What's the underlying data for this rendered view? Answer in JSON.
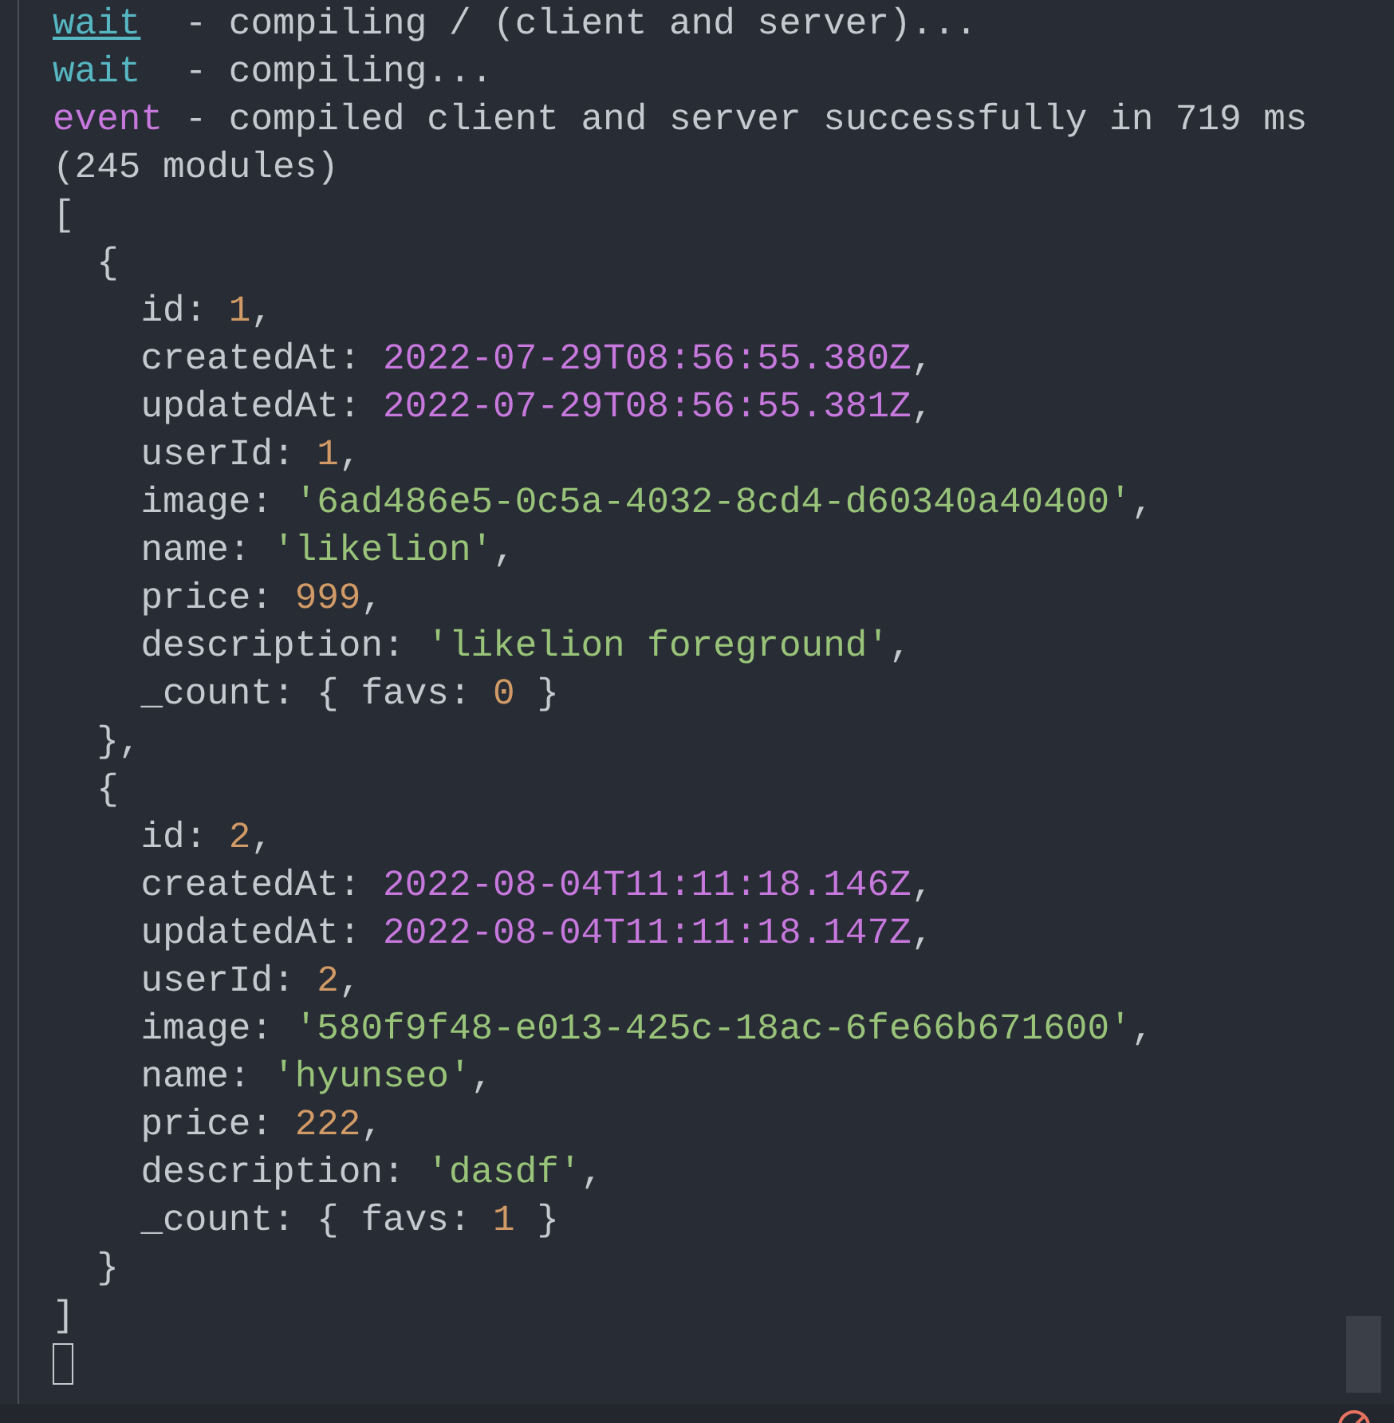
{
  "terminal": {
    "lines": [
      {
        "segments": [
          {
            "text": "wait",
            "kind": "link"
          },
          {
            "text": "  - compiling / (client and server)...",
            "kind": "plain"
          }
        ]
      },
      {
        "segments": [
          {
            "text": "wait",
            "kind": "info"
          },
          {
            "text": "  - compiling...",
            "kind": "plain"
          }
        ]
      },
      {
        "segments": [
          {
            "text": "event",
            "kind": "event"
          },
          {
            "text": " - compiled client and server successfully in 719 ms",
            "kind": "plain"
          }
        ]
      },
      {
        "segments": [
          {
            "text": "(245 modules)",
            "kind": "plain"
          }
        ]
      },
      {
        "segments": [
          {
            "text": "[",
            "kind": "plain"
          }
        ]
      },
      {
        "segments": [
          {
            "text": "  {",
            "kind": "plain"
          }
        ]
      },
      {
        "segments": [
          {
            "text": "    id: ",
            "kind": "plain"
          },
          {
            "text": "1",
            "kind": "number"
          },
          {
            "text": ",",
            "kind": "plain"
          }
        ]
      },
      {
        "segments": [
          {
            "text": "    createdAt: ",
            "kind": "plain"
          },
          {
            "text": "2022-07-29T08:56:55.380Z",
            "kind": "date"
          },
          {
            "text": ",",
            "kind": "plain"
          }
        ]
      },
      {
        "segments": [
          {
            "text": "    updatedAt: ",
            "kind": "plain"
          },
          {
            "text": "2022-07-29T08:56:55.381Z",
            "kind": "date"
          },
          {
            "text": ",",
            "kind": "plain"
          }
        ]
      },
      {
        "segments": [
          {
            "text": "    userId: ",
            "kind": "plain"
          },
          {
            "text": "1",
            "kind": "number"
          },
          {
            "text": ",",
            "kind": "plain"
          }
        ]
      },
      {
        "segments": [
          {
            "text": "    image: ",
            "kind": "plain"
          },
          {
            "text": "'6ad486e5-0c5a-4032-8cd4-d60340a40400'",
            "kind": "string"
          },
          {
            "text": ",",
            "kind": "plain"
          }
        ]
      },
      {
        "segments": [
          {
            "text": "    name: ",
            "kind": "plain"
          },
          {
            "text": "'likelion'",
            "kind": "string"
          },
          {
            "text": ",",
            "kind": "plain"
          }
        ]
      },
      {
        "segments": [
          {
            "text": "    price: ",
            "kind": "plain"
          },
          {
            "text": "999",
            "kind": "number"
          },
          {
            "text": ",",
            "kind": "plain"
          }
        ]
      },
      {
        "segments": [
          {
            "text": "    description: ",
            "kind": "plain"
          },
          {
            "text": "'likelion foreground'",
            "kind": "string"
          },
          {
            "text": ",",
            "kind": "plain"
          }
        ]
      },
      {
        "segments": [
          {
            "text": "    _count: { favs: ",
            "kind": "plain"
          },
          {
            "text": "0",
            "kind": "number"
          },
          {
            "text": " }",
            "kind": "plain"
          }
        ]
      },
      {
        "segments": [
          {
            "text": "  },",
            "kind": "plain"
          }
        ]
      },
      {
        "segments": [
          {
            "text": "  {",
            "kind": "plain"
          }
        ]
      },
      {
        "segments": [
          {
            "text": "    id: ",
            "kind": "plain"
          },
          {
            "text": "2",
            "kind": "number"
          },
          {
            "text": ",",
            "kind": "plain"
          }
        ]
      },
      {
        "segments": [
          {
            "text": "    createdAt: ",
            "kind": "plain"
          },
          {
            "text": "2022-08-04T11:11:18.146Z",
            "kind": "date"
          },
          {
            "text": ",",
            "kind": "plain"
          }
        ]
      },
      {
        "segments": [
          {
            "text": "    updatedAt: ",
            "kind": "plain"
          },
          {
            "text": "2022-08-04T11:11:18.147Z",
            "kind": "date"
          },
          {
            "text": ",",
            "kind": "plain"
          }
        ]
      },
      {
        "segments": [
          {
            "text": "    userId: ",
            "kind": "plain"
          },
          {
            "text": "2",
            "kind": "number"
          },
          {
            "text": ",",
            "kind": "plain"
          }
        ]
      },
      {
        "segments": [
          {
            "text": "    image: ",
            "kind": "plain"
          },
          {
            "text": "'580f9f48-e013-425c-18ac-6fe66b671600'",
            "kind": "string"
          },
          {
            "text": ",",
            "kind": "plain"
          }
        ]
      },
      {
        "segments": [
          {
            "text": "    name: ",
            "kind": "plain"
          },
          {
            "text": "'hyunseo'",
            "kind": "string"
          },
          {
            "text": ",",
            "kind": "plain"
          }
        ]
      },
      {
        "segments": [
          {
            "text": "    price: ",
            "kind": "plain"
          },
          {
            "text": "222",
            "kind": "number"
          },
          {
            "text": ",",
            "kind": "plain"
          }
        ]
      },
      {
        "segments": [
          {
            "text": "    description: ",
            "kind": "plain"
          },
          {
            "text": "'dasdf'",
            "kind": "string"
          },
          {
            "text": ",",
            "kind": "plain"
          }
        ]
      },
      {
        "segments": [
          {
            "text": "    _count: { favs: ",
            "kind": "plain"
          },
          {
            "text": "1",
            "kind": "number"
          },
          {
            "text": " }",
            "kind": "plain"
          }
        ]
      },
      {
        "segments": [
          {
            "text": "  }",
            "kind": "plain"
          }
        ]
      },
      {
        "segments": [
          {
            "text": "]",
            "kind": "plain"
          }
        ]
      }
    ],
    "cursor_visible": true
  }
}
